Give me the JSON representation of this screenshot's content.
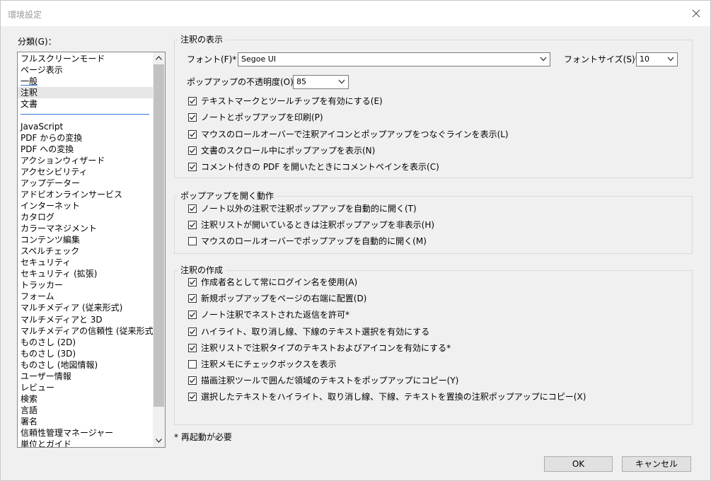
{
  "window": {
    "title": "環境設定"
  },
  "sidebar": {
    "label": "分類(G)：",
    "items": [
      "フルスクリーンモード",
      "ページ表示",
      "一般",
      "注釈",
      "文書",
      "JavaScript",
      "PDF からの変換",
      "PDF への変換",
      "アクションウィザード",
      "アクセシビリティ",
      "アップデーター",
      "アドビオンラインサービス",
      "インターネット",
      "カタログ",
      "カラーマネジメント",
      "コンテンツ編集",
      "スペルチェック",
      "セキュリティ",
      "セキュリティ (拡張)",
      "トラッカー",
      "フォーム",
      "マルチメディア (従来形式)",
      "マルチメディアと 3D",
      "マルチメディアの信頼性 (従来形式)",
      "ものさし (2D)",
      "ものさし (3D)",
      "ものさし (地図情報)",
      "ユーザー情報",
      "レビュー",
      "検索",
      "言語",
      "署名",
      "信頼性管理マネージャー",
      "単位とガイド"
    ],
    "selected": "注釈",
    "focused": "一般"
  },
  "display_group": {
    "title": "注釈の表示",
    "font_label": "フォント(F)*：",
    "font_value": "Segoe UI",
    "font_size_label": "フォントサイズ(S)*：",
    "font_size_value": "10",
    "opacity_label": "ポップアップの不透明度(O)：",
    "opacity_value": "85",
    "checkboxes": [
      {
        "label": "テキストマークとツールチップを有効にする(E)",
        "checked": true
      },
      {
        "label": "ノートとポップアップを印刷(P)",
        "checked": true
      },
      {
        "label": "マウスのロールオーバーで注釈アイコンとポップアップをつなぐラインを表示(L)",
        "checked": true
      },
      {
        "label": "文書のスクロール中にポップアップを表示(N)",
        "checked": true
      },
      {
        "label": "コメント付きの PDF を開いたときにコメントペインを表示(C)",
        "checked": true
      }
    ]
  },
  "popup_group": {
    "title": "ポップアップを開く動作",
    "checkboxes": [
      {
        "label": "ノート以外の注釈で注釈ポップアップを自動的に開く(T)",
        "checked": true
      },
      {
        "label": "注釈リストが開いているときは注釈ポップアップを非表示(H)",
        "checked": true
      },
      {
        "label": "マウスのロールオーバーでポップアップを自動的に開く(M)",
        "checked": false
      }
    ]
  },
  "create_group": {
    "title": "注釈の作成",
    "checkboxes": [
      {
        "label": "作成者名として常にログイン名を使用(A)",
        "checked": true
      },
      {
        "label": "新規ポップアップをページの右端に配置(D)",
        "checked": true
      },
      {
        "label": "ノート注釈でネストされた返信を許可*",
        "checked": true
      },
      {
        "label": "ハイライト、取り消し線、下線のテキスト選択を有効にする",
        "checked": true
      },
      {
        "label": "注釈リストで注釈タイプのテキストおよびアイコンを有効にする*",
        "checked": true
      },
      {
        "label": "注釈メモにチェックボックスを表示",
        "checked": false
      },
      {
        "label": "描画注釈ツールで囲んだ領域のテキストをポップアップにコピー(Y)",
        "checked": true
      },
      {
        "label": "選択したテキストをハイライト、取り消し線、下線、テキストを置換の注釈ポップアップにコピー(X)",
        "checked": true
      }
    ]
  },
  "footer": {
    "note": "* 再起動が必要",
    "ok_label": "OK",
    "cancel_label": "キャンセル"
  },
  "colors": {
    "accent": "#2f7ad6",
    "selected_bg": "#e6e6e6",
    "dialog_bg": "#f0f0f0"
  }
}
